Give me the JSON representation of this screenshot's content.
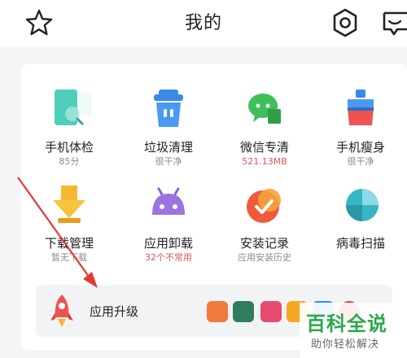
{
  "header": {
    "title": "我的"
  },
  "tools": [
    {
      "label": "手机体检",
      "sub": "85分",
      "icon": "phone-check-icon"
    },
    {
      "label": "垃圾清理",
      "sub": "很干净",
      "icon": "trash-icon"
    },
    {
      "label": "微信专清",
      "sub": "521.13MB",
      "icon": "wechat-clean-icon"
    },
    {
      "label": "手机瘦身",
      "sub": "很干净",
      "icon": "slim-icon"
    },
    {
      "label": "下载管理",
      "sub": "暂无下载",
      "icon": "download-icon"
    },
    {
      "label": "应用卸载",
      "sub": "32个不常用",
      "icon": "android-uninstall-icon"
    },
    {
      "label": "安装记录",
      "sub": "应用安装历史",
      "icon": "install-record-icon"
    },
    {
      "label": "病毒扫描",
      "sub": "",
      "icon": "virus-scan-icon"
    }
  ],
  "upgrade": {
    "label": "应用升级"
  },
  "watermark": {
    "main": "百科全说",
    "sub": "助你轻松解决"
  },
  "colors": {
    "accent_red": "#e0575b",
    "watermark_green": "#2ca84a"
  }
}
